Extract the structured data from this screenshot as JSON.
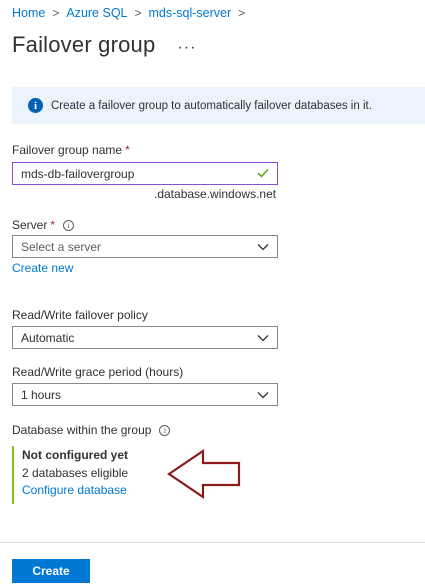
{
  "breadcrumb": {
    "items": [
      "Home",
      "Azure SQL",
      "mds-sql-server"
    ]
  },
  "page": {
    "title": "Failover group",
    "more_label": "···"
  },
  "info": {
    "text": "Create a failover group to automatically failover databases in it."
  },
  "form": {
    "name_label": "Failover group name",
    "name_value": "mds-db-failovergroup",
    "name_suffix": ".database.windows.net",
    "server_label": "Server",
    "server_placeholder": "Select a server",
    "create_new_label": "Create new",
    "policy_label": "Read/Write failover policy",
    "policy_value": "Automatic",
    "grace_label": "Read/Write grace period (hours)",
    "grace_value": "1 hours",
    "db_label": "Database within the group",
    "db_status": "Not configured yet",
    "db_count": "2 databases eligible",
    "db_configure_label": "Configure database",
    "required_mark": "*"
  },
  "footer": {
    "create_label": "Create"
  },
  "colors": {
    "accent": "#0078d4",
    "info_bg": "#ebf3fc",
    "arrow": "#8b1a1a",
    "valid_check": "#57a300"
  }
}
